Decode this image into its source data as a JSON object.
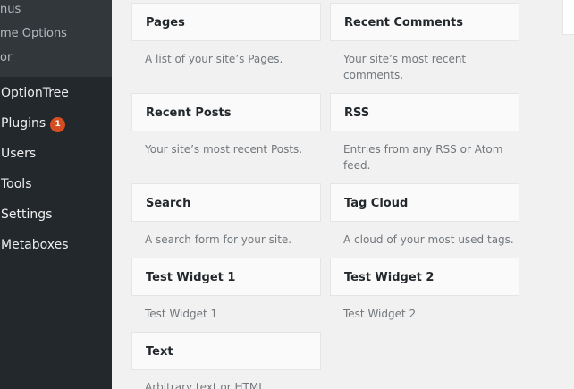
{
  "sidebar": {
    "submenu": [
      "nus",
      "me Options",
      "or"
    ],
    "menu": [
      {
        "label": "OptionTree"
      },
      {
        "label": "Plugins",
        "badge": "1"
      },
      {
        "label": "Users"
      },
      {
        "label": "Tools"
      },
      {
        "label": "Settings"
      },
      {
        "label": "Metaboxes"
      }
    ]
  },
  "widgets": [
    {
      "title": "Pages",
      "description": "A list of your site’s Pages."
    },
    {
      "title": "Recent Comments",
      "description": "Your site’s most recent comments."
    },
    {
      "title": "Recent Posts",
      "description": "Your site’s most recent Posts."
    },
    {
      "title": "RSS",
      "description": "Entries from any RSS or Atom feed."
    },
    {
      "title": "Search",
      "description": "A search form for your site."
    },
    {
      "title": "Tag Cloud",
      "description": "A cloud of your most used tags."
    },
    {
      "title": "Test Widget 1",
      "description": "Test Widget 1"
    },
    {
      "title": "Test Widget 2",
      "description": "Test Widget 2"
    },
    {
      "title": "Text",
      "description": "Arbitrary text or HTML."
    }
  ],
  "colors": {
    "sidebar_bg": "#23282d",
    "submenu_bg": "#32373c",
    "badge": "#d54e21",
    "content_bg": "#f1f1f1"
  }
}
